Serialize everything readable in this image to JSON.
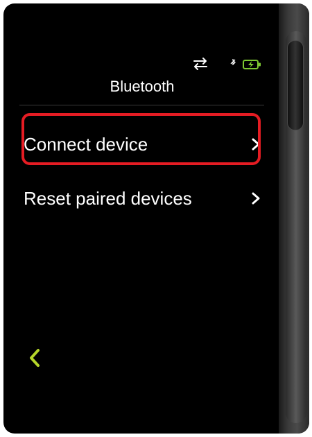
{
  "screen": {
    "title": "Bluetooth"
  },
  "status_bar": {
    "icons": [
      "transfer-arrows-icon",
      "bluetooth-small-icon",
      "battery-charging-icon"
    ],
    "battery_color": "#7ec832"
  },
  "menu": {
    "items": [
      {
        "label": "Connect device",
        "icon": "chevron-right-icon",
        "highlighted": true
      },
      {
        "label": "Reset paired devices",
        "icon": "chevron-right-icon",
        "highlighted": false
      }
    ]
  },
  "navigation": {
    "back_icon": "chevron-left-icon",
    "back_color": "#b5d62a"
  },
  "colors": {
    "background": "#000000",
    "text": "#ffffff",
    "highlight": "#e51c23"
  }
}
